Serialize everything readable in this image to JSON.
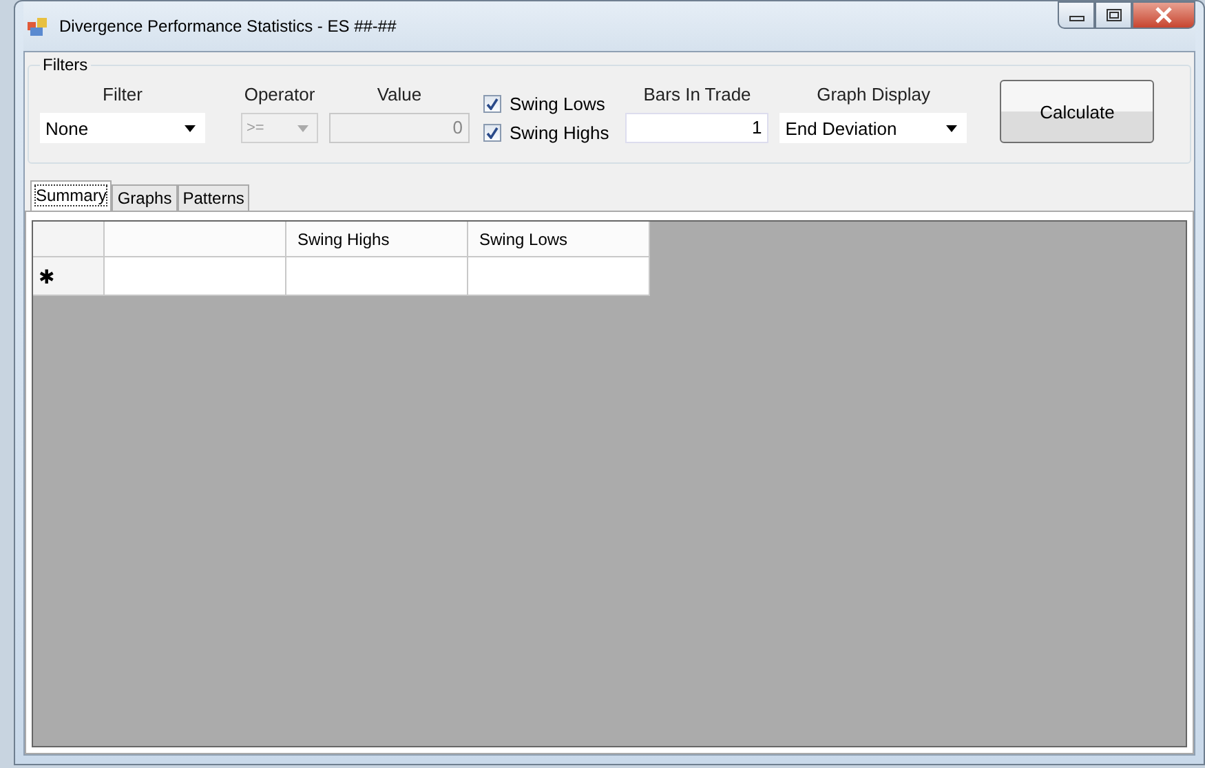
{
  "window": {
    "title": "Divergence Performance Statistics - ES ##-##"
  },
  "filters": {
    "title": "Filters",
    "filter": {
      "label": "Filter",
      "value": "None"
    },
    "operator": {
      "label": "Operator",
      "value": ">=",
      "disabled": true
    },
    "value": {
      "label": "Value",
      "value": "0",
      "disabled": true
    },
    "checkboxes": [
      {
        "label": "Swing Lows",
        "checked": true
      },
      {
        "label": "Swing Highs",
        "checked": true
      }
    ],
    "bars_in_trade": {
      "label": "Bars In Trade",
      "value": "1"
    },
    "graph_display": {
      "label": "Graph Display",
      "value": "End Deviation"
    },
    "calculate_button": "Calculate"
  },
  "tabs": [
    {
      "label": "Summary",
      "selected": true
    },
    {
      "label": "Graphs",
      "selected": false
    },
    {
      "label": "Patterns",
      "selected": false
    }
  ],
  "grid": {
    "columns": [
      "Swing Highs",
      "Swing Lows"
    ],
    "new_row_marker": "✱"
  }
}
